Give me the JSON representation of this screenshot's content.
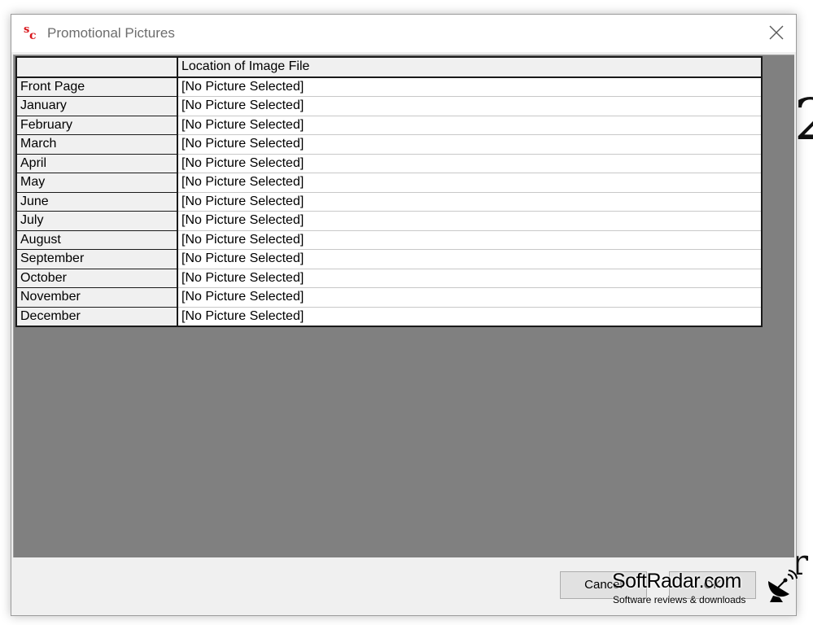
{
  "background": {
    "glyph_top": "2",
    "glyph_bottom": "r"
  },
  "dialog": {
    "title": "Promotional Pictures",
    "icon": "app-logo-icon",
    "close_icon": "close-icon"
  },
  "grid": {
    "column_header": "Location of Image File",
    "rows": [
      {
        "label": "Front Page",
        "value": "[No Picture Selected]"
      },
      {
        "label": "January",
        "value": "[No Picture Selected]"
      },
      {
        "label": "February",
        "value": "[No Picture Selected]"
      },
      {
        "label": "March",
        "value": "[No Picture Selected]"
      },
      {
        "label": "April",
        "value": "[No Picture Selected]"
      },
      {
        "label": "May",
        "value": "[No Picture Selected]"
      },
      {
        "label": "June",
        "value": "[No Picture Selected]"
      },
      {
        "label": "July",
        "value": "[No Picture Selected]"
      },
      {
        "label": "August",
        "value": "[No Picture Selected]"
      },
      {
        "label": "September",
        "value": "[No Picture Selected]"
      },
      {
        "label": "October",
        "value": "[No Picture Selected]"
      },
      {
        "label": "November",
        "value": "[No Picture Selected]"
      },
      {
        "label": "December",
        "value": "[No Picture Selected]"
      }
    ]
  },
  "buttons": {
    "cancel": "Cancel",
    "ok": "OK"
  },
  "watermark": {
    "brand": "SoftRadar.com",
    "tagline": "Software reviews & downloads",
    "icon": "satellite-dish-icon"
  },
  "colors": {
    "client_background": "#808080",
    "logo_red": "#d9151b"
  }
}
